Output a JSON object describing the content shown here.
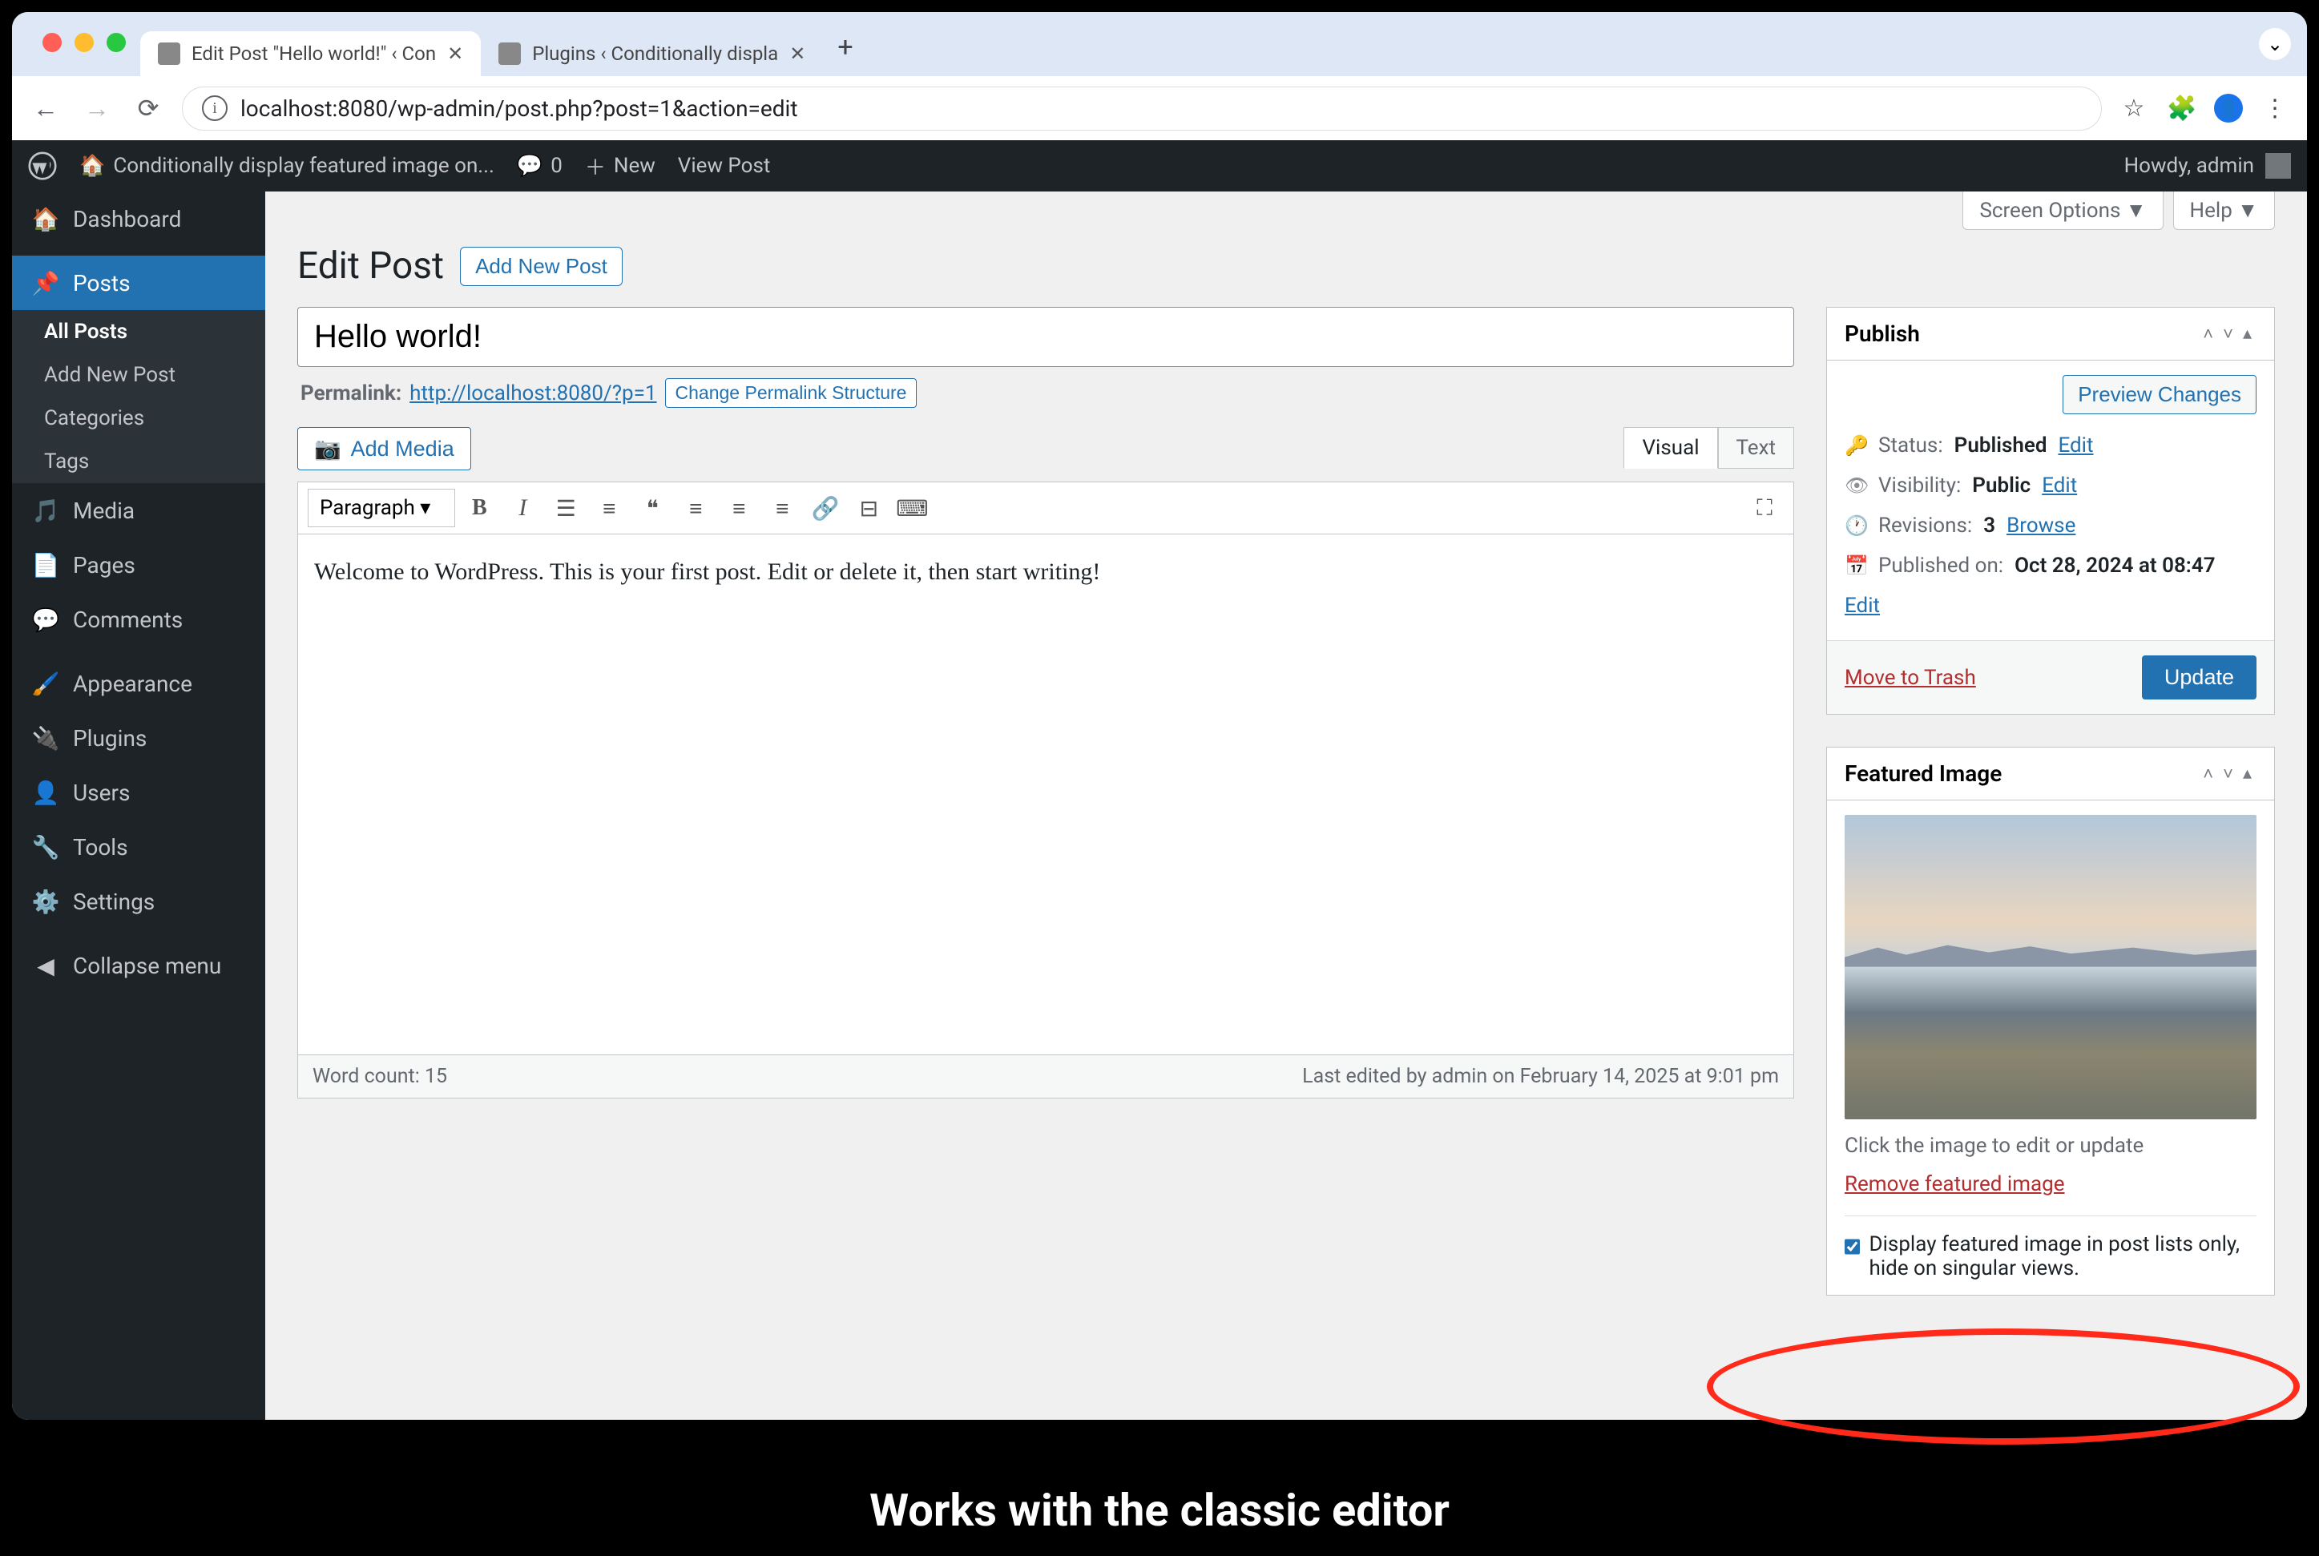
{
  "browser": {
    "tabs": [
      {
        "title": "Edit Post \"Hello world!\" ‹ Con",
        "active": true
      },
      {
        "title": "Plugins ‹ Conditionally displa",
        "active": false
      }
    ],
    "url": "localhost:8080/wp-admin/post.php?post=1&action=edit"
  },
  "adminbar": {
    "site_name": "Conditionally display featured image on...",
    "comments_count": "0",
    "new_label": "New",
    "view_post": "View Post",
    "howdy": "Howdy, admin"
  },
  "sidebar": {
    "items": [
      {
        "label": "Dashboard",
        "icon": "dashboard"
      },
      {
        "label": "Posts",
        "icon": "pin",
        "current": true,
        "submenu": [
          {
            "label": "All Posts",
            "current": true
          },
          {
            "label": "Add New Post"
          },
          {
            "label": "Categories"
          },
          {
            "label": "Tags"
          }
        ]
      },
      {
        "label": "Media",
        "icon": "media"
      },
      {
        "label": "Pages",
        "icon": "pages"
      },
      {
        "label": "Comments",
        "icon": "comments"
      },
      {
        "label": "Appearance",
        "icon": "brush"
      },
      {
        "label": "Plugins",
        "icon": "plug"
      },
      {
        "label": "Users",
        "icon": "user"
      },
      {
        "label": "Tools",
        "icon": "wrench"
      },
      {
        "label": "Settings",
        "icon": "sliders"
      }
    ],
    "collapse": "Collapse menu"
  },
  "screen_meta": {
    "screen_options": "Screen Options",
    "help": "Help"
  },
  "header": {
    "title": "Edit Post",
    "add_new": "Add New Post"
  },
  "post": {
    "title_value": "Hello world!",
    "permalink_label": "Permalink:",
    "permalink_url": "http://localhost:8080/?p=1",
    "change_permalink": "Change Permalink Structure",
    "add_media": "Add Media",
    "tabs": {
      "visual": "Visual",
      "text": "Text"
    },
    "format_dropdown": "Paragraph",
    "content": "Welcome to WordPress. This is your first post. Edit or delete it, then start writing!",
    "word_count": "Word count: 15",
    "last_edited": "Last edited by admin on February 14, 2025 at 9:01 pm"
  },
  "publish": {
    "box_title": "Publish",
    "preview": "Preview Changes",
    "status_label": "Status:",
    "status_value": "Published",
    "status_edit": "Edit",
    "visibility_label": "Visibility:",
    "visibility_value": "Public",
    "visibility_edit": "Edit",
    "revisions_label": "Revisions:",
    "revisions_value": "3",
    "revisions_browse": "Browse",
    "published_label": "Published on:",
    "published_value": "Oct 28, 2024 at 08:47",
    "published_edit": "Edit",
    "trash": "Move to Trash",
    "update": "Update"
  },
  "featured": {
    "box_title": "Featured Image",
    "hint": "Click the image to edit or update",
    "remove": "Remove featured image",
    "checkbox_label": "Display featured image in post lists only, hide on singular views.",
    "checkbox_checked": true
  },
  "caption": "Works with the classic editor"
}
